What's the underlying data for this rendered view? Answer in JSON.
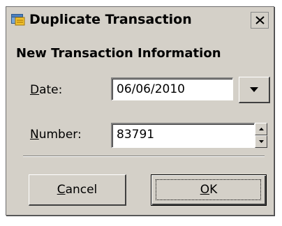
{
  "window": {
    "title": "Duplicate Transaction",
    "icon": "app-wallet-icon",
    "close_icon": "close-icon"
  },
  "form": {
    "heading": "New Transaction Information",
    "date": {
      "label_mnemonic": "D",
      "label_rest": "ate:",
      "value": "06/06/2010",
      "dropdown_icon": "chevron-down-icon"
    },
    "number": {
      "label_mnemonic": "N",
      "label_rest": "umber:",
      "value": "83791",
      "spin_up_icon": "spin-up-icon",
      "spin_down_icon": "spin-down-icon"
    }
  },
  "buttons": {
    "cancel_mnemonic": "C",
    "cancel_rest": "ancel",
    "ok_mnemonic": "O",
    "ok_rest": "K"
  },
  "colors": {
    "dialog_bg": "#d4d0c8",
    "input_bg": "#ffffff",
    "text": "#000000"
  }
}
